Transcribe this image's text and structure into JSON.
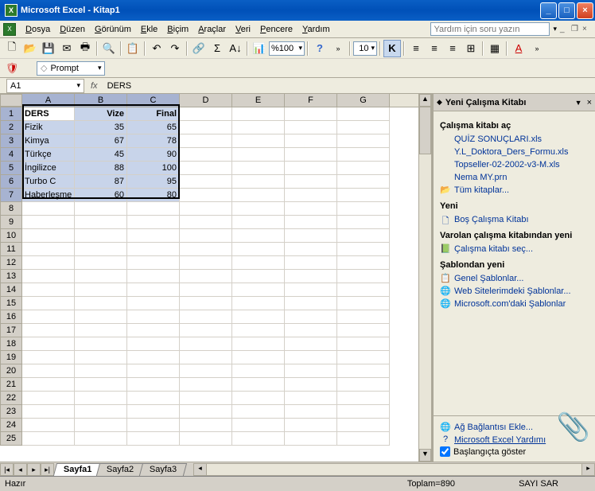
{
  "title": "Microsoft Excel - Kitap1",
  "menu": [
    "Dosya",
    "Düzen",
    "Görünüm",
    "Ekle",
    "Biçim",
    "Araçlar",
    "Veri",
    "Pencere",
    "Yardım"
  ],
  "helpPlaceholder": "Yardım için soru yazın",
  "zoom": "%100",
  "fontSize": "10",
  "promptBox": "Prompt",
  "nameBox": "A1",
  "formulaValue": "DERS",
  "colHeaders": [
    "A",
    "B",
    "C",
    "D",
    "E",
    "F",
    "G"
  ],
  "selCols": [
    "A",
    "B",
    "C"
  ],
  "selRows": [
    1,
    2,
    3,
    4,
    5,
    6,
    7
  ],
  "rowCount": 25,
  "cells": {
    "headers": [
      "DERS",
      "Vize",
      "Final"
    ],
    "rows": [
      [
        "Fizik",
        "35",
        "65"
      ],
      [
        "Kimya",
        "67",
        "78"
      ],
      [
        "Türkçe",
        "45",
        "90"
      ],
      [
        "İngilizce",
        "88",
        "100"
      ],
      [
        "Turbo C",
        "87",
        "95"
      ],
      [
        "Haberleşme",
        "60",
        "80"
      ]
    ]
  },
  "taskpane": {
    "title": "Yeni Çalışma Kitabı",
    "sec1": "Çalışma kitabı aç",
    "recent": [
      "QUİZ SONUÇLARI.xls",
      "Y.L_Doktora_Ders_Formu.xls",
      "Topseller-02-2002-v3-M.xls",
      "Nema MY.prn"
    ],
    "allBooks": "Tüm kitaplar...",
    "sec2": "Yeni",
    "blank": "Boş Çalışma Kitabı",
    "sec3": "Varolan çalışma kitabından yeni",
    "chooseBook": "Çalışma kitabı seç...",
    "sec4": "Şablondan yeni",
    "tmpl": [
      "Genel Şablonlar...",
      "Web Sitelerimdeki Şablonlar...",
      "Microsoft.com'daki Şablonlar"
    ],
    "netLoc": "Ağ Bağlantısı Ekle...",
    "help": "Microsoft Excel Yardımı",
    "showStart": "Başlangıçta göster"
  },
  "sheets": [
    "Sayfa1",
    "Sayfa2",
    "Sayfa3"
  ],
  "status": {
    "ready": "Hazır",
    "sum": "Toplam=890",
    "ind": "SAYI SAR"
  }
}
